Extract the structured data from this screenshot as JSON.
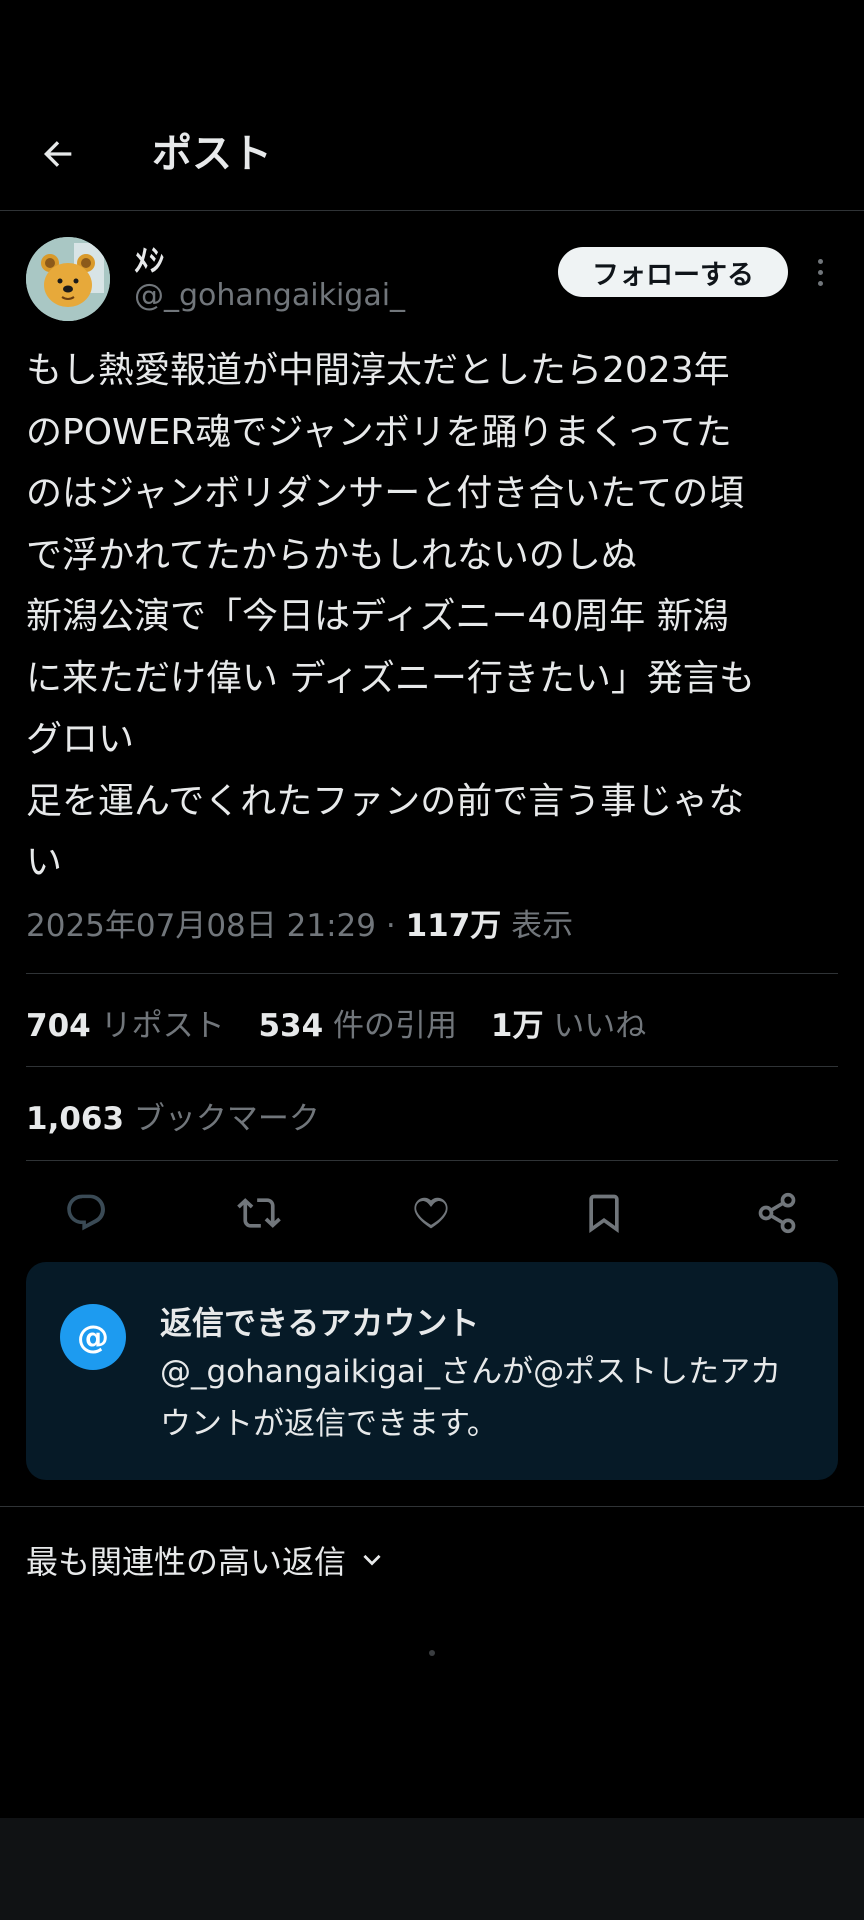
{
  "header": {
    "title": "ポスト"
  },
  "author": {
    "name": "ﾒｼ",
    "handle": "@_gohangaikigai_"
  },
  "follow_label": "フォローする",
  "tweet_lines": [
    "もし熱愛報道が中間淳太だとしたら2023年",
    "のPOWER魂でジャンボリを踊りまくってた",
    "のはジャンボリダンサーと付き合いたての頃",
    "で浮かれてたからかもしれないのしぬ",
    "新潟公演で「今日はディズニー40周年 新潟",
    "に来ただけ偉い ディズニー行きたい」発言も",
    "グロい",
    "足を運んでくれたファンの前で言う事じゃな",
    "い"
  ],
  "meta": {
    "timestamp": "2025年07月08日 21:29",
    "separator": "·",
    "views": "117万",
    "views_label": "表示"
  },
  "stats": {
    "reposts": "704",
    "reposts_label": "リポスト",
    "quotes": "534",
    "quotes_label": "件の引用",
    "likes": "1万",
    "likes_label": "いいね"
  },
  "bookmarks": {
    "count": "1,063",
    "label": "ブックマーク"
  },
  "actions": [
    "reply-icon",
    "repost-icon",
    "like-icon",
    "bookmark-icon",
    "share-icon"
  ],
  "reply_card": {
    "icon": "@",
    "title": "返信できるアカウント",
    "body_line1": "@_gohangaikigai_さんが@ポストしたアカ",
    "body_line2": "ウントが返信できます。"
  },
  "sort": {
    "label": "最も関連性の高い返信"
  },
  "colors": {
    "accent": "#1d9bf0",
    "muted": "#71767b",
    "text": "#e7e9ea",
    "card_bg": "#061a27"
  }
}
